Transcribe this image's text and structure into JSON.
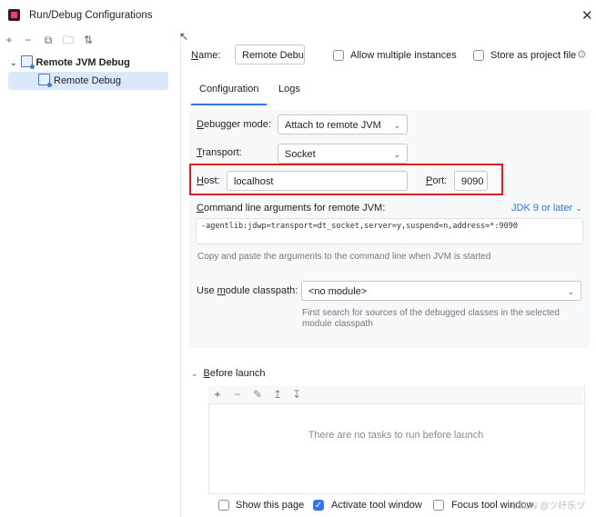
{
  "window": {
    "title": "Run/Debug Configurations"
  },
  "toolbar": {
    "icons": [
      "add-icon",
      "remove-icon",
      "copy-icon",
      "new-folder-icon",
      "sort-icon"
    ]
  },
  "tree": {
    "parent_label": "Remote JVM Debug",
    "child_label": "Remote Debug"
  },
  "form": {
    "name_label": "Name:",
    "name_value": "Remote Debu",
    "allow_multiple_label": "Allow multiple instances",
    "store_project_label": "Store as project file",
    "tabs": [
      "Configuration",
      "Logs"
    ],
    "debugger_mode_label": "Debugger mode:",
    "debugger_mode_value": "Attach to remote JVM",
    "transport_label": "Transport:",
    "transport_value": "Socket",
    "host_label": "Host:",
    "host_value": "localhost",
    "port_label": "Port:",
    "port_value": "9090",
    "cmd_label": "Command line arguments for remote JVM:",
    "jdk_link": "JDK 9 or later",
    "cmd_value": "-agentlib:jdwp=transport=dt_socket,server=y,suspend=n,address=*:9090",
    "cmd_hint": "Copy and paste the arguments to the command line when JVM is started",
    "module_label": "Use module classpath:",
    "module_value": "<no module>",
    "module_hint_1": "First search for sources of the debugged classes in the selected",
    "module_hint_2": "module classpath"
  },
  "before_launch": {
    "label": "Before launch",
    "empty_text": "There are no tasks to run before launch"
  },
  "footer": {
    "show_page_label": "Show this page",
    "activate_tool_label": "Activate tool window",
    "focus_tool_label": "Focus tool window",
    "watermark": "CSDN @ツ纤乐ヅ"
  },
  "colors": {
    "accent": "#3574f0",
    "highlight": "#e02020"
  }
}
